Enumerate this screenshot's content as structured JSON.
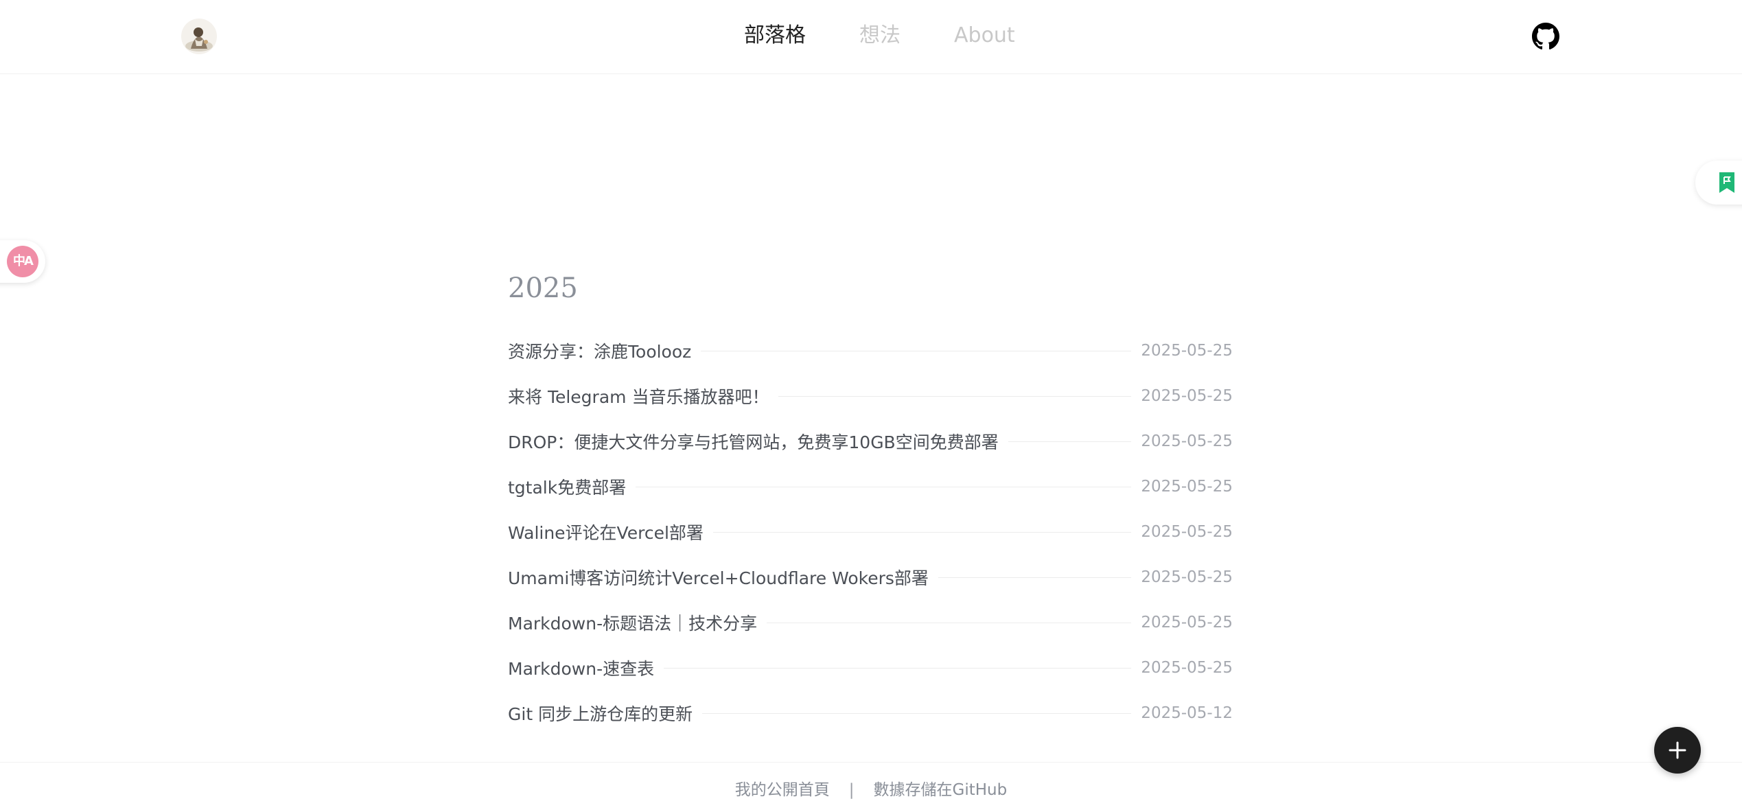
{
  "header": {
    "nav": [
      {
        "label": "部落格",
        "active": true
      },
      {
        "label": "想法",
        "active": false
      },
      {
        "label": "About",
        "active": false
      }
    ],
    "avatar_icon": "avatar",
    "github_icon": "github-icon"
  },
  "side": {
    "translate_glyph": "中A",
    "translate_icon": "translate-icon",
    "bookmark_icon": "bookmark-icon",
    "bookmark_color": "#1fb876"
  },
  "main": {
    "year": "2025",
    "posts": [
      {
        "title": "资源分享：涂鹿Toolooz",
        "date": "2025-05-25"
      },
      {
        "title": "来将 Telegram 当音乐播放器吧！",
        "date": "2025-05-25"
      },
      {
        "title": "DROP：便捷大文件分享与托管网站，免费享10GB空间免费部署",
        "date": "2025-05-25"
      },
      {
        "title": "tgtalk免费部署",
        "date": "2025-05-25"
      },
      {
        "title": "Waline评论在Vercel部署",
        "date": "2025-05-25"
      },
      {
        "title": "Umami博客访问统计Vercel+Cloudflare Wokers部署",
        "date": "2025-05-25"
      },
      {
        "title": "Markdown-标题语法｜技术分享",
        "date": "2025-05-25"
      },
      {
        "title": "Markdown-速查表",
        "date": "2025-05-25"
      },
      {
        "title": "Git 同步上游仓库的更新",
        "date": "2025-05-12"
      }
    ]
  },
  "footer": {
    "home_link": "我的公開首頁",
    "separator": "|",
    "storage_link": "數據存儲在GitHub"
  },
  "fab": {
    "icon": "plus-icon"
  }
}
